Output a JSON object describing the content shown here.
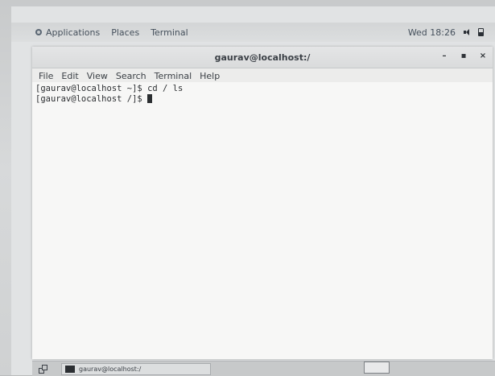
{
  "top_panel": {
    "applications": "Applications",
    "places": "Places",
    "terminal": "Terminal",
    "clock": "Wed 18:26"
  },
  "window": {
    "title": "gaurav@localhost:/",
    "controls": {
      "minimize": "–",
      "maximize": "▪",
      "close": "×"
    },
    "menu": [
      "File",
      "Edit",
      "View",
      "Search",
      "Terminal",
      "Help"
    ]
  },
  "terminal": {
    "lines": [
      "[gaurav@localhost ~]$ cd / ls",
      "[gaurav@localhost /]$ "
    ]
  },
  "taskbar": {
    "task_label": "gaurav@localhost:/"
  }
}
